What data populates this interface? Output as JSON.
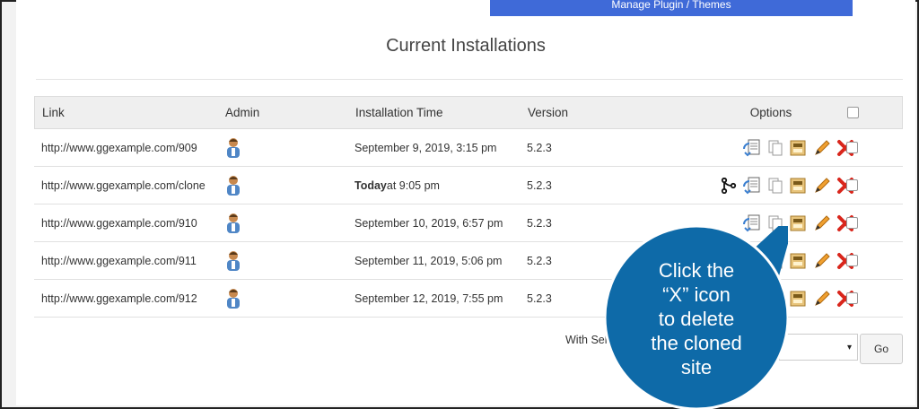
{
  "top_button": {
    "label": "Manage Plugin / Themes"
  },
  "section": {
    "title": "Current Installations"
  },
  "table": {
    "headers": {
      "link": "Link",
      "admin": "Admin",
      "time": "Installation Time",
      "version": "Version",
      "options": "Options"
    },
    "rows": [
      {
        "link": "http://www.ggexample.com/909",
        "time": "September 9, 2019, 3:15 pm",
        "version": "5.2.3"
      },
      {
        "link": "http://www.ggexample.com/clone",
        "time_bold": "Today",
        "time_rest": " at 9:05 pm",
        "version": "5.2.3"
      },
      {
        "link": "http://www.ggexample.com/910",
        "time": "September 10, 2019, 6:57 pm",
        "version": "5.2.3"
      },
      {
        "link": "http://www.ggexample.com/911",
        "time": "September 11, 2019, 5:06 pm",
        "version": "5.2.3"
      },
      {
        "link": "http://www.ggexample.com/912",
        "time": "September 12, 2019, 7:55 pm",
        "version": "5.2.3"
      }
    ]
  },
  "footer": {
    "with_selected": "With Sel",
    "go": "Go"
  },
  "callout": {
    "line1": "Click the",
    "line2": "“X” icon",
    "line3": "to delete",
    "line4": "the cloned",
    "line5": "site"
  },
  "colors": {
    "accent": "#3f6ad8",
    "callout": "#0e6aa8",
    "delete": "#d9261c",
    "edit": "#f0a030"
  }
}
